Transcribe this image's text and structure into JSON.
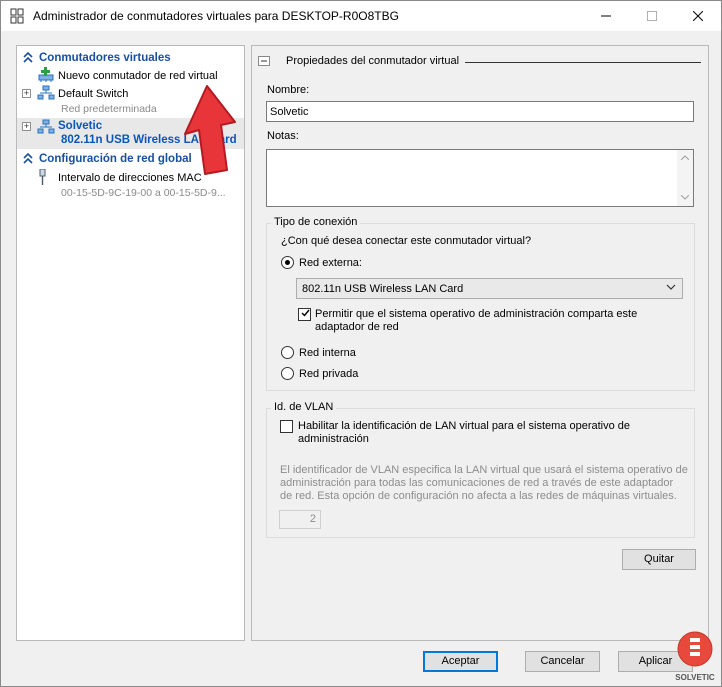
{
  "window": {
    "title": "Administrador de conmutadores virtuales para DESKTOP-R0O8TBG"
  },
  "left": {
    "sections": [
      {
        "label": "Conmutadores virtuales"
      },
      {
        "label": "Configuración de red global"
      }
    ],
    "new_switch": "Nuevo conmutador de red virtual",
    "default_switch": {
      "label": "Default Switch",
      "sub": "Red predeterminada"
    },
    "selected_switch": {
      "label": "Solvetic",
      "sub": "802.11n USB Wireless LAN Card"
    },
    "mac_range": {
      "label": "Intervalo de direcciones MAC",
      "sub": "00-15-5D-9C-19-00 a 00-15-5D-9..."
    }
  },
  "right": {
    "header": "Propiedades del conmutador virtual",
    "name_label": "Nombre:",
    "name_value": "Solvetic",
    "notes_label": "Notas:",
    "notes_value": "",
    "connection": {
      "title": "Tipo de conexión",
      "question": "¿Con qué desea conectar este conmutador virtual?",
      "external_label": "Red externa:",
      "adapter_selected": "802.11n USB Wireless LAN Card",
      "allow_mgmt_line1": "Permitir que el sistema operativo de administración comparta este",
      "allow_mgmt_line2": "adaptador de red",
      "internal_label": "Red interna",
      "private_label": "Red privada",
      "selected": "external"
    },
    "vlan": {
      "title": "Id. de VLAN",
      "enable_line1": "Habilitar la identificación de LAN virtual para el sistema operativo de",
      "enable_line2": "administración",
      "desc_line1": "El identificador de VLAN especifica la LAN virtual que usará el sistema operativo de",
      "desc_line2": "administración para todas las comunicaciones de red a través de este adaptador",
      "desc_line3": "de red. Esta opción de configuración no afecta a las redes de máquinas virtuales.",
      "value": "2"
    },
    "remove_button": "Quitar"
  },
  "footer": {
    "accept": "Aceptar",
    "cancel": "Cancelar",
    "apply": "Aplicar"
  },
  "watermark": "SOLVETIC"
}
